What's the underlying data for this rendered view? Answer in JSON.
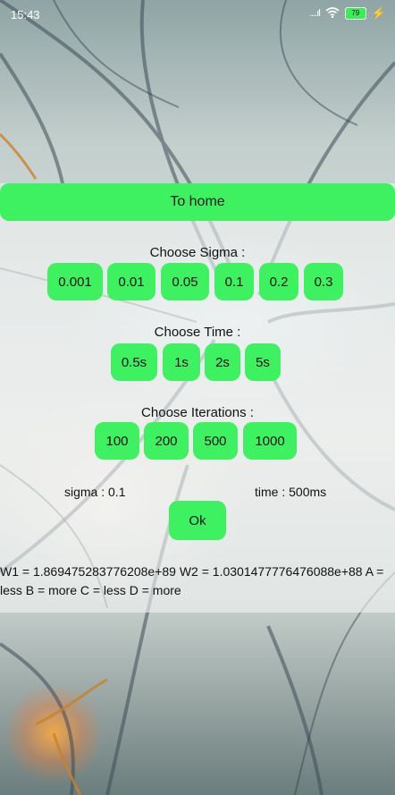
{
  "status": {
    "time": "15:43",
    "signal": "....ıl",
    "battery": "79"
  },
  "home_button": "To home",
  "sigma": {
    "label": "Choose Sigma :",
    "options": [
      "0.001",
      "0.01",
      "0.05",
      "0.1",
      "0.2",
      "0.3"
    ]
  },
  "time": {
    "label": "Choose Time :",
    "options": [
      "0.5s",
      "1s",
      "2s",
      "5s"
    ]
  },
  "iterations": {
    "label": "Choose Iterations :",
    "options": [
      "100",
      "200",
      "500",
      "1000"
    ]
  },
  "summary": {
    "sigma": "sigma : 0.1",
    "time": "time : 500ms"
  },
  "ok_button": "Ok",
  "result": "W1 = 1.869475283776208e+89 W2 = 1.0301477776476088e+88 A = less B = more C = less D = more",
  "colors": {
    "accent": "#3ef160"
  }
}
